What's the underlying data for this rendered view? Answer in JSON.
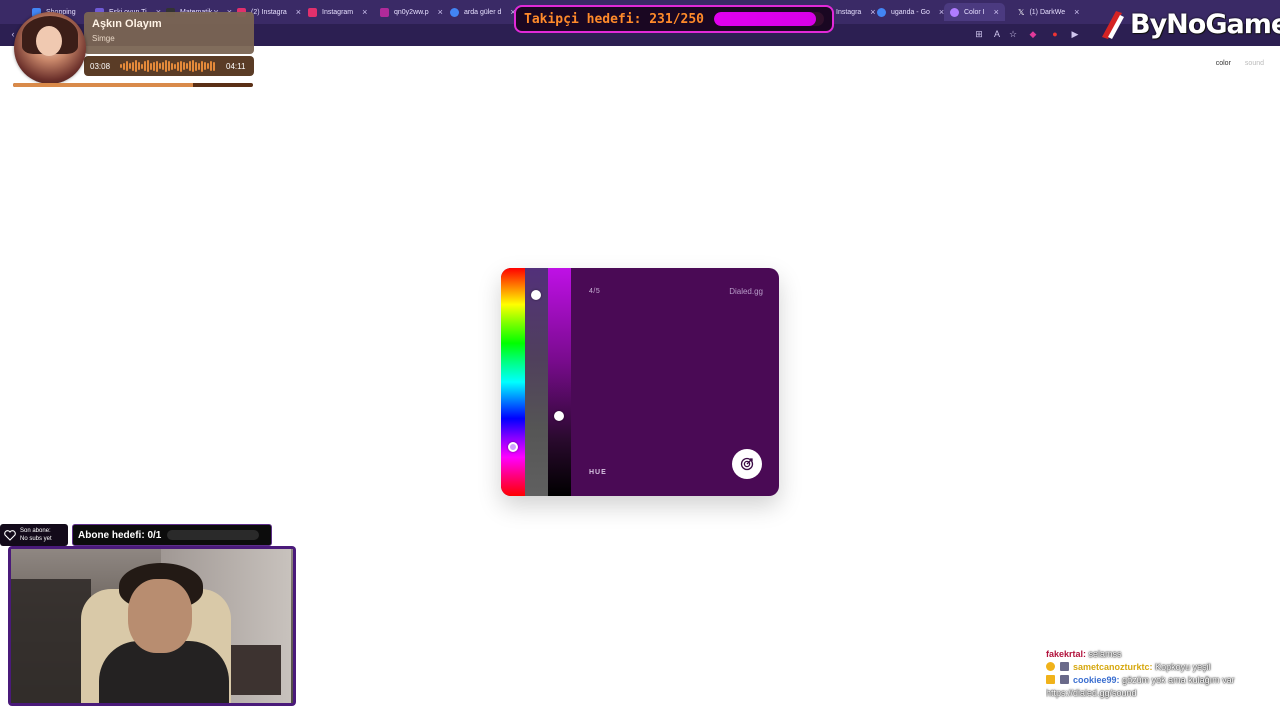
{
  "browser": {
    "tabs": [
      {
        "label": "Shopping",
        "color": "#4285f4"
      },
      {
        "label": "Eski oyun Ti",
        "color": "#6f5bd6"
      },
      {
        "label": "Matematik v",
        "color": "#333333"
      },
      {
        "label": "(2) Instagra",
        "color": "#e1306c"
      },
      {
        "label": "Instagram",
        "color": "#e1306c"
      },
      {
        "label": "qn0y2ww.p",
        "color": "#b02a9a"
      },
      {
        "label": "arda güler d",
        "color": "#4285f4"
      },
      {
        "label": "Instagra",
        "color": "#e1306c"
      },
      {
        "label": "uganda - Go",
        "color": "#4285f4"
      },
      {
        "label": "Color I",
        "color": "#b07cff"
      },
      {
        "label": "(1) DarkWe",
        "color": "#000000"
      }
    ]
  },
  "overlay": {
    "follower_goal": {
      "text": "Takipçi hedefi: 231/250",
      "progress": 0.924
    },
    "logo": "ByNoGame",
    "music": {
      "title": "Aşkın Olayım",
      "artist": "Simge",
      "elapsed": "03:08",
      "total": "04:11",
      "progress": 0.749
    },
    "last_sub": {
      "line1": "Son abone:",
      "line2": "No subs yet"
    },
    "sub_goal": {
      "text": "Abone hedefi: 0/1",
      "progress": 0
    }
  },
  "page_nav": {
    "color": "color",
    "sound": "sound"
  },
  "game": {
    "round": "4/5",
    "brand": "Dialed.gg",
    "slider_label": "HUE",
    "background_color": "#4a0a55",
    "hue_value": 0.78,
    "saturation_value": 0.1,
    "brightness_value": 0.65
  },
  "chat": [
    {
      "user": "fakekrtal:",
      "message": "selamss",
      "user_color": "#b2123c"
    },
    {
      "user": "sametcanozturktc:",
      "message": "Kopkoyu yeşil",
      "user_color": "#d6a80f"
    },
    {
      "user": "cookiee99:",
      "message": "gözüm yok ama kulağım var",
      "user_color": "#3b6fd0"
    },
    {
      "user": "",
      "message": "https://dialed.gg/sound",
      "user_color": "#ffffff"
    }
  ]
}
